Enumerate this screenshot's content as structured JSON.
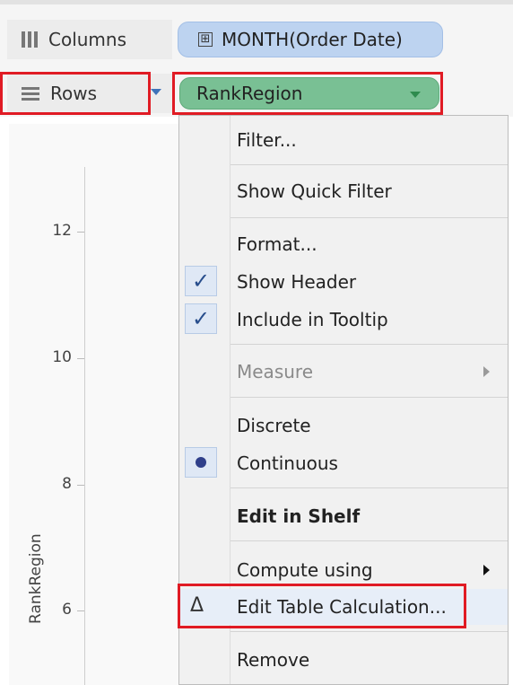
{
  "shelves": {
    "columns_label": "Columns",
    "rows_label": "Rows",
    "columns_pill": "MONTH(Order Date)",
    "columns_pill_icon": "⊞",
    "rows_pill": "RankRegion"
  },
  "axis": {
    "title": "RankRegion",
    "ticks": [
      "12",
      "10",
      "8",
      "6"
    ]
  },
  "menu": {
    "items": [
      {
        "label": "Filter..."
      },
      {
        "label": "Show Quick Filter"
      },
      {
        "label": "Format..."
      },
      {
        "label": "Show Header",
        "checked": true
      },
      {
        "label": "Include in Tooltip",
        "checked": true
      },
      {
        "label": "Measure",
        "disabled": true,
        "submenu": true
      },
      {
        "label": "Discrete"
      },
      {
        "label": "Continuous",
        "selected": true
      },
      {
        "label": "Edit in Shelf",
        "bold": true
      },
      {
        "label": "Compute using",
        "submenu": true
      },
      {
        "label": "Edit Table Calculation...",
        "icon": "Δ"
      },
      {
        "label": "Remove"
      }
    ],
    "check_glyph": "✓"
  },
  "colors": {
    "rows_pill": "#79c094",
    "columns_pill": "#bdd3f0",
    "highlight": "#e01b24"
  }
}
